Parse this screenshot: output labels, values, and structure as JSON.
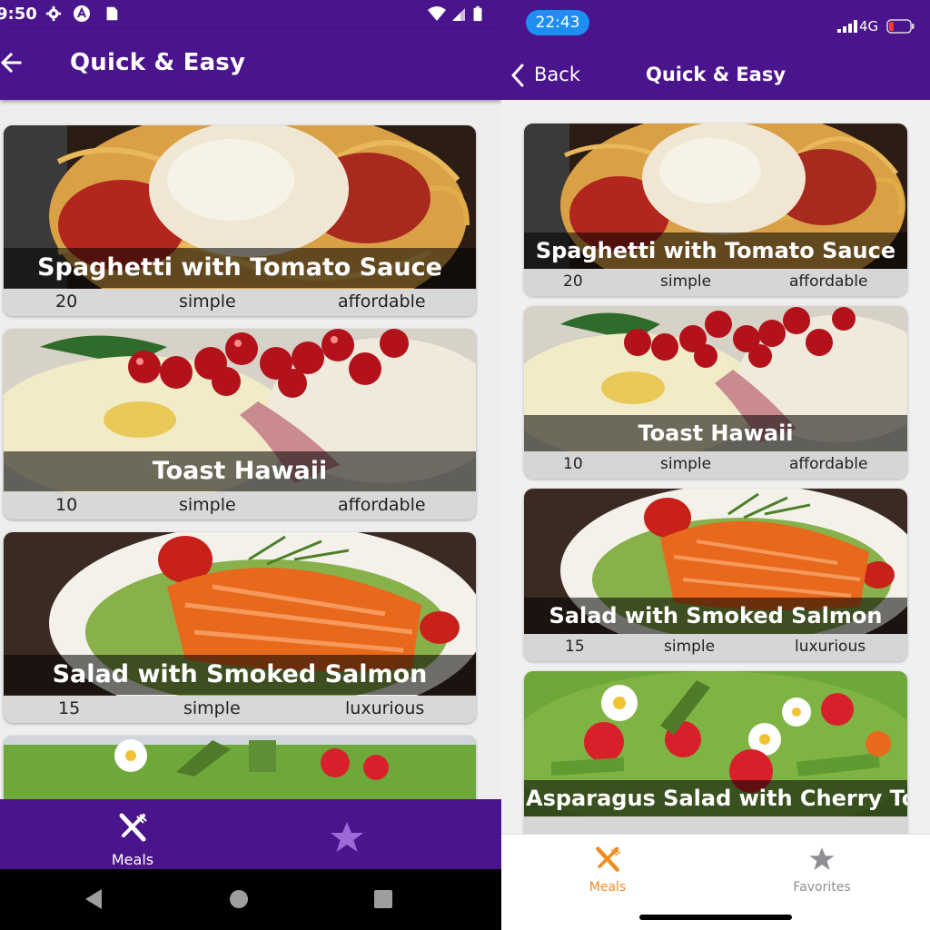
{
  "android": {
    "status_time": "9:50",
    "title": "Quick & Easy",
    "meals": [
      {
        "title": "Spaghetti with Tomato Sauce",
        "duration": "20",
        "complexity": "simple",
        "affordability": "affordable"
      },
      {
        "title": "Toast Hawaii",
        "duration": "10",
        "complexity": "simple",
        "affordability": "affordable"
      },
      {
        "title": "Salad with Smoked Salmon",
        "duration": "15",
        "complexity": "simple",
        "affordability": "luxurious"
      }
    ],
    "nav": {
      "meals_label": "Meals",
      "meals_icon": "fork-knife-icon",
      "favorites_icon": "star-icon"
    },
    "colors": {
      "primary": "#4a148c",
      "background": "#eeeeee",
      "inactive": "#9c6ad6"
    }
  },
  "ios": {
    "status_time": "22:43",
    "network": "4G",
    "back_label": "Back",
    "title": "Quick & Easy",
    "meals": [
      {
        "title": "Spaghetti with Tomato Sauce",
        "duration": "20",
        "complexity": "simple",
        "affordability": "affordable"
      },
      {
        "title": "Toast Hawaii",
        "duration": "10",
        "complexity": "simple",
        "affordability": "affordable"
      },
      {
        "title": "Salad with Smoked Salmon",
        "duration": "15",
        "complexity": "simple",
        "affordability": "luxurious"
      },
      {
        "title": "Asparagus Salad with Cherry Tom"
      }
    ],
    "tabs": [
      {
        "label": "Meals",
        "icon": "fork-knife-icon",
        "active": true
      },
      {
        "label": "Favorites",
        "icon": "star-icon",
        "active": false
      }
    ],
    "colors": {
      "primary": "#4a148c",
      "active_tab": "#f08c1e",
      "inactive_tab": "#8e8e93"
    }
  }
}
